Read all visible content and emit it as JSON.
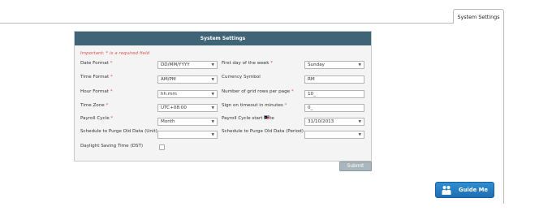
{
  "tab": {
    "label": "System Settings"
  },
  "panel": {
    "title": "System Settings",
    "required_note": "Important: * is a required field"
  },
  "fields": {
    "date_format": {
      "label": "Date Format",
      "value": "DD/MM/YYYY"
    },
    "first_day": {
      "label": "First day of the week",
      "value": "Sunday"
    },
    "time_format": {
      "label": "Time Format",
      "value": "AM/PM"
    },
    "currency_symbol": {
      "label": "Currency Symbol",
      "value": "RM"
    },
    "hour_format": {
      "label": "Hour Format",
      "value": "hh.mm"
    },
    "grid_rows": {
      "label": "Number of grid rows per page",
      "value": "10_"
    },
    "time_zone": {
      "label": "Time Zone",
      "value": "UTC+08:00"
    },
    "sign_on_timeout": {
      "label": "Sign on timeout in minutes",
      "value": "0_"
    },
    "payroll_cycle": {
      "label": "Payroll Cycle",
      "value": "Month"
    },
    "payroll_start_date": {
      "label": "Payroll Cycle start date",
      "value": "31/10/2013"
    },
    "purge_unit": {
      "label": "Schedule to Purge Old Data (Unit)",
      "value": ""
    },
    "purge_period": {
      "label": "Schedule to Purge Old Data (Period)",
      "value": ""
    },
    "dst": {
      "label": "Daylight Saving Time (DST)",
      "checked": false
    }
  },
  "required_marker": "*",
  "buttons": {
    "submit": "Submit",
    "guide_me": "Guide Me"
  },
  "icons": {
    "dropdown": "chevron-down-icon",
    "calendar_flag": "flag-icon",
    "guide": "people-icon"
  },
  "colors": {
    "header_bg": "#3f6476",
    "required": "#d9534f",
    "guide_button": "#1f6eb1",
    "submit_button": "#a9b6bd"
  }
}
